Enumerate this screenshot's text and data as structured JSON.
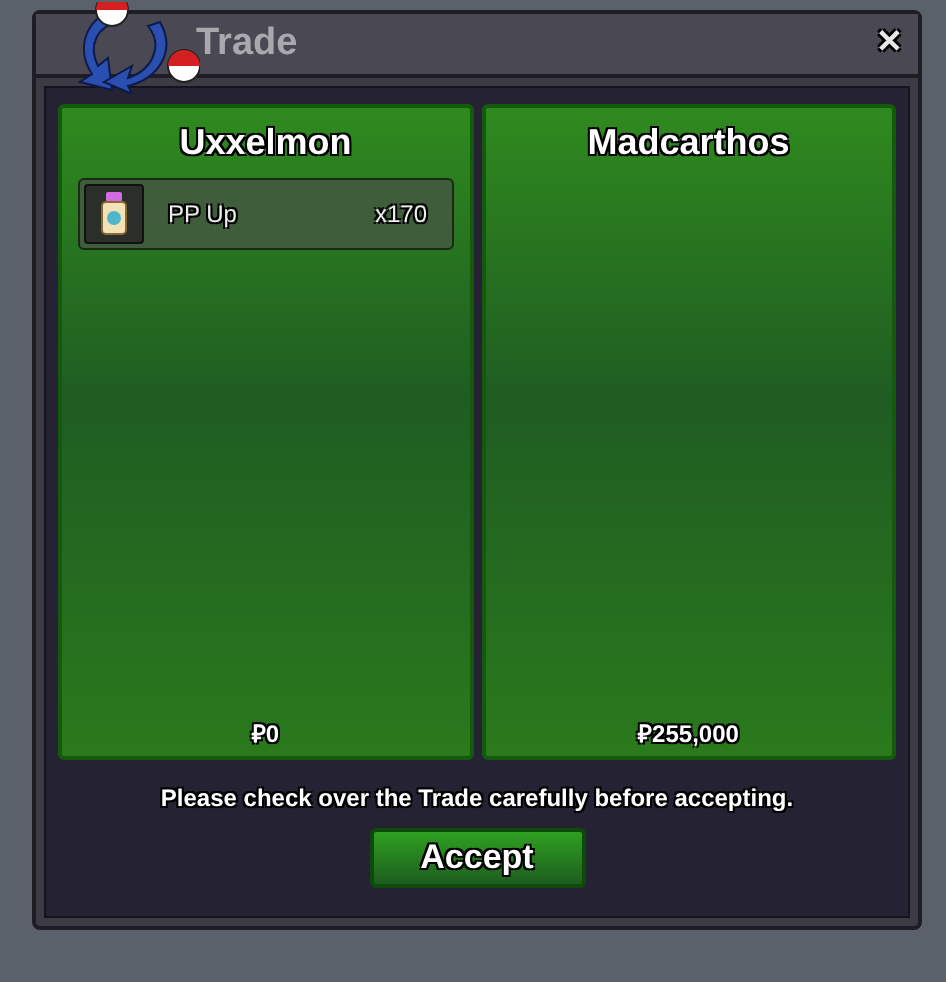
{
  "window": {
    "title": "Trade",
    "close": "✕"
  },
  "sides": [
    {
      "name": "Uxxelmon",
      "items": [
        {
          "name": "PP Up",
          "quantity": "x170"
        }
      ],
      "money": "₽0"
    },
    {
      "name": "Madcarthos",
      "money": "₽255,000"
    }
  ],
  "notice": "Please check over the Trade carefully before accepting.",
  "buttons": [
    {
      "label": "Accept"
    }
  ]
}
